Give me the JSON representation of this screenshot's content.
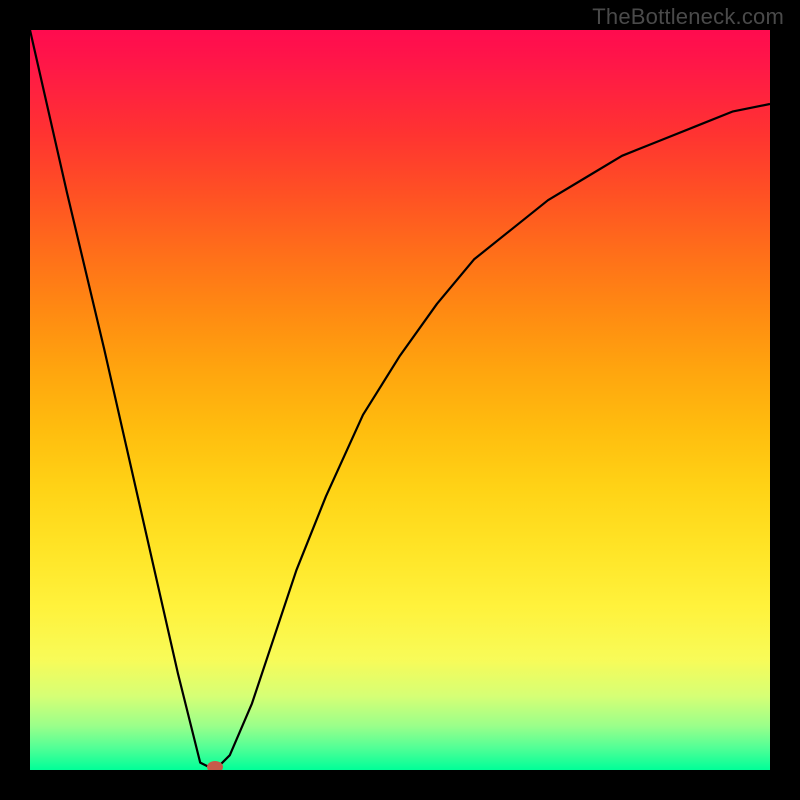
{
  "watermark": "TheBottleneck.com",
  "chart_data": {
    "type": "line",
    "title": "",
    "xlabel": "",
    "ylabel": "",
    "xlim": [
      0,
      100
    ],
    "ylim": [
      0,
      100
    ],
    "x": [
      0,
      5,
      10,
      15,
      20,
      23,
      25,
      27,
      30,
      33,
      36,
      40,
      45,
      50,
      55,
      60,
      65,
      70,
      75,
      80,
      85,
      90,
      95,
      100
    ],
    "values": [
      100,
      78,
      57,
      35,
      13,
      1,
      0,
      2,
      9,
      18,
      27,
      37,
      48,
      56,
      63,
      69,
      73,
      77,
      80,
      83,
      85,
      87,
      89,
      90
    ],
    "min_marker": {
      "x": 25,
      "y": 0
    },
    "series": [
      {
        "name": "curve",
        "values_ref": "values"
      }
    ]
  }
}
